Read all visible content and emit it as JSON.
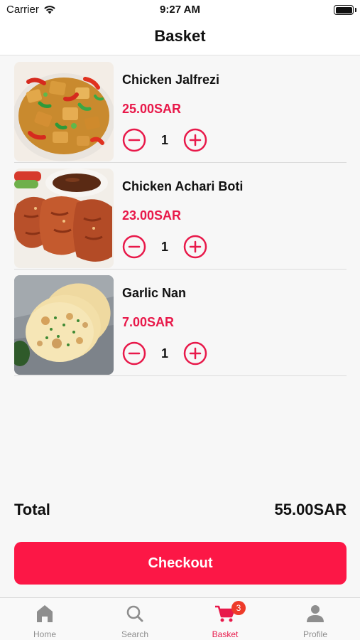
{
  "status_bar": {
    "carrier": "Carrier",
    "time": "9:27 AM"
  },
  "header": {
    "title": "Basket"
  },
  "items": [
    {
      "name": "Chicken Jalfrezi",
      "price": "25.00SAR",
      "quantity": "1"
    },
    {
      "name": "Chicken Achari Boti",
      "price": "23.00SAR",
      "quantity": "1"
    },
    {
      "name": "Garlic Nan",
      "price": "7.00SAR",
      "quantity": "1"
    }
  ],
  "summary": {
    "total_label": "Total",
    "total_value": "55.00SAR"
  },
  "checkout": {
    "label": "Checkout"
  },
  "tabs": [
    {
      "label": "Home",
      "icon": "home-icon"
    },
    {
      "label": "Search",
      "icon": "search-icon"
    },
    {
      "label": "Basket",
      "icon": "cart-icon",
      "badge": "3",
      "active": true
    },
    {
      "label": "Profile",
      "icon": "profile-icon"
    }
  ],
  "colors": {
    "accent": "#fc1746",
    "price": "#e8194a",
    "badge": "#ee3b2a"
  }
}
